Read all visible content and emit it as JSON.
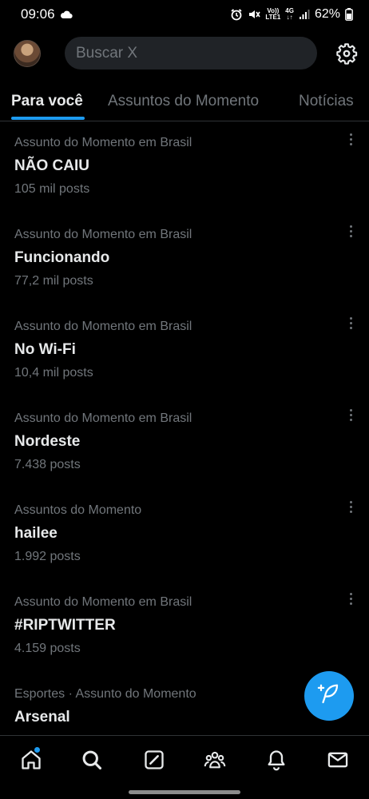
{
  "status_bar": {
    "time": "09:06",
    "volte_line1": "Vo))",
    "volte_line2": "LTE1",
    "net_line1": "4G",
    "net_line2": "↓↑",
    "battery": "62%"
  },
  "search": {
    "placeholder": "Buscar X"
  },
  "tabs": [
    {
      "label": "Para você",
      "active": true
    },
    {
      "label": "Assuntos do Momento",
      "active": false
    },
    {
      "label": "Notícias",
      "active": false
    }
  ],
  "trends": [
    {
      "context": "Assunto do Momento em Brasil",
      "name": "NÃO CAIU",
      "count": "105 mil posts"
    },
    {
      "context": "Assunto do Momento em Brasil",
      "name": "Funcionando",
      "count": "77,2 mil posts"
    },
    {
      "context": "Assunto do Momento em Brasil",
      "name": "No Wi-Fi",
      "count": "10,4 mil posts"
    },
    {
      "context": "Assunto do Momento em Brasil",
      "name": "Nordeste",
      "count": "7.438 posts"
    },
    {
      "context": "Assuntos do Momento",
      "name": "hailee",
      "count": "1.992 posts"
    },
    {
      "context": "Assunto do Momento em Brasil",
      "name": "#RIPTWITTER",
      "count": "4.159 posts"
    },
    {
      "context": "Esportes · Assunto do Momento",
      "name": "Arsenal",
      "count": ""
    }
  ],
  "icons": {
    "settings": "gear-icon",
    "compose": "compose-post-icon",
    "nav": [
      "home-icon",
      "search-icon",
      "grok-icon",
      "communities-icon",
      "notifications-icon",
      "messages-icon"
    ]
  },
  "colors": {
    "accent": "#1d9bf0",
    "background": "#000000",
    "secondary_text": "#71767b",
    "primary_text": "#e7e9ea"
  }
}
